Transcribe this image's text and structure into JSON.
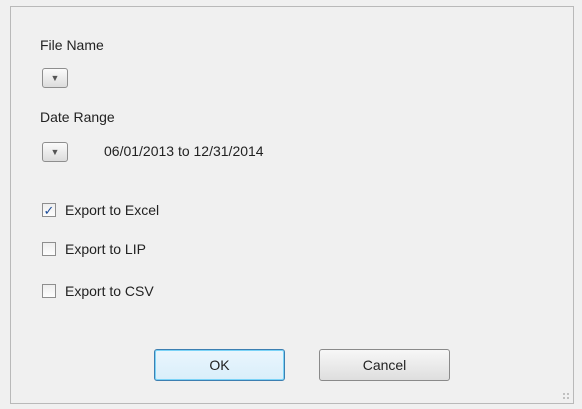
{
  "dialog": {
    "file_name_label": "File Name",
    "date_range_label": "Date Range",
    "date_range_value": "06/01/2013 to 12/31/2014",
    "dropdown_glyph": "▼",
    "options": [
      {
        "label": "Export to Excel",
        "checked": true
      },
      {
        "label": "Export to LIP",
        "checked": false
      },
      {
        "label": "Export to CSV",
        "checked": false
      }
    ],
    "check_glyph": "✓",
    "ok_label": "OK",
    "cancel_label": "Cancel"
  },
  "icons": {
    "dropdown": "chevron-down-icon",
    "check": "checkmark-icon",
    "resize": "resize-grip-icon"
  },
  "colors": {
    "background": "#f0f0f0",
    "default_button_border": "#3c7fb1",
    "check_mark": "#1d4d9a"
  }
}
